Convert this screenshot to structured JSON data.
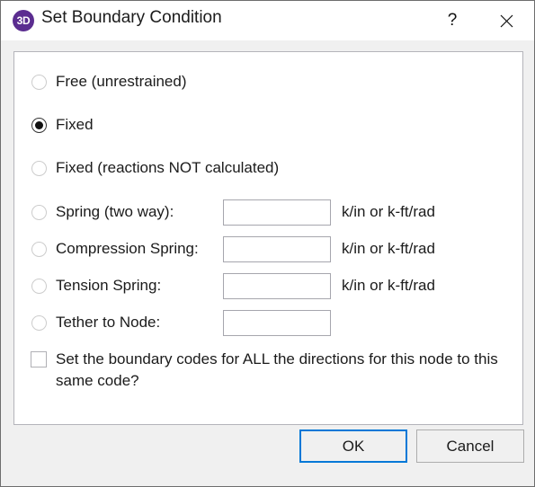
{
  "window": {
    "title": "Set Boundary Condition",
    "icon_label": "3D",
    "icon_name": "app-3d-icon",
    "accent_color": "#5b2d90",
    "focus_color": "#0078d7",
    "help_label": "?",
    "close_label": "✕"
  },
  "options": [
    {
      "id": "free",
      "label": "Free (unrestrained)",
      "selected": false,
      "has_field": false,
      "value": "",
      "units": ""
    },
    {
      "id": "fixed",
      "label": "Fixed",
      "selected": true,
      "has_field": false,
      "value": "",
      "units": ""
    },
    {
      "id": "fixed-no-reactions",
      "label": "Fixed (reactions NOT calculated)",
      "selected": false,
      "has_field": false,
      "value": "",
      "units": ""
    },
    {
      "id": "spring-two-way",
      "label": "Spring (two way):",
      "selected": false,
      "has_field": true,
      "value": "",
      "units": "k/in or k-ft/rad"
    },
    {
      "id": "compression-spring",
      "label": "Compression Spring:",
      "selected": false,
      "has_field": true,
      "value": "",
      "units": "k/in or k-ft/rad"
    },
    {
      "id": "tension-spring",
      "label": "Tension Spring:",
      "selected": false,
      "has_field": true,
      "value": "",
      "units": "k/in or k-ft/rad"
    },
    {
      "id": "tether-to-node",
      "label": "Tether to Node:",
      "selected": false,
      "has_field": true,
      "value": "",
      "units": ""
    }
  ],
  "checkbox": {
    "label": "Set the boundary codes for ALL the directions for this node to this same code?",
    "checked": false
  },
  "footer": {
    "ok_label": "OK",
    "cancel_label": "Cancel"
  }
}
